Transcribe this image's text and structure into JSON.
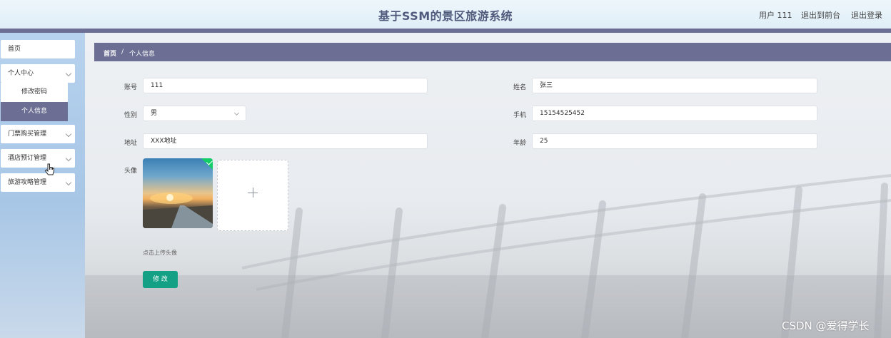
{
  "header": {
    "title": "基于SSM的景区旅游系统",
    "user_label": "用户 111",
    "to_front_label": "退出到前台",
    "logout_label": "退出登录"
  },
  "sidebar": {
    "items": [
      {
        "label": "首页"
      },
      {
        "label": "个人中心",
        "expanded": true
      },
      {
        "label": "门票购买管理"
      },
      {
        "label": "酒店预订管理"
      },
      {
        "label": "旅游攻略管理"
      }
    ],
    "submenu": [
      {
        "label": "修改密码"
      },
      {
        "label": "个人信息",
        "active": true
      }
    ]
  },
  "breadcrumb": {
    "home": "首页",
    "separator": "/",
    "current": "个人信息"
  },
  "form": {
    "account": {
      "label": "账号",
      "value": "111"
    },
    "name": {
      "label": "姓名",
      "value": "张三"
    },
    "gender": {
      "label": "性别",
      "value": "男"
    },
    "phone": {
      "label": "手机",
      "value": "15154525452"
    },
    "address": {
      "label": "地址",
      "value": "XXX地址"
    },
    "age": {
      "label": "年龄",
      "value": "25"
    },
    "avatar": {
      "label": "头像",
      "hint": "点击上传头像"
    },
    "submit_label": "修 改"
  },
  "watermark": "CSDN @爱得学长",
  "colors": {
    "accent": "#6c6f93",
    "primary_button": "#13a085",
    "success": "#13ce66",
    "title": "#4f5a7c"
  },
  "icons": [
    "chevron-down-icon",
    "plus-icon",
    "check-icon",
    "pointer-cursor-icon"
  ]
}
